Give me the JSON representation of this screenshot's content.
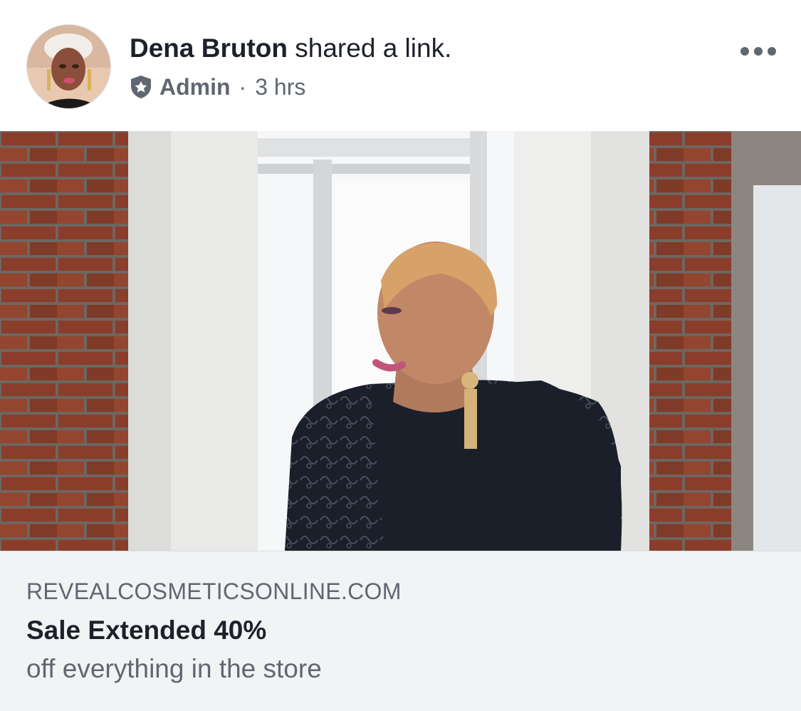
{
  "post": {
    "author_name": "Dena Bruton",
    "action_text": " shared a link.",
    "role": "Admin",
    "separator": "·",
    "timestamp": "3 hrs",
    "more_icon": "more-horizontal-icon",
    "role_icon": "admin-shield-icon"
  },
  "link": {
    "domain": "REVEALCOSMETICSONLINE.COM",
    "title": "Sale Extended 40%",
    "description": "off everything in the store"
  },
  "colors": {
    "primary_text": "#1d2129",
    "secondary_text": "#606770",
    "caption_bg": "#f2f3f5"
  }
}
